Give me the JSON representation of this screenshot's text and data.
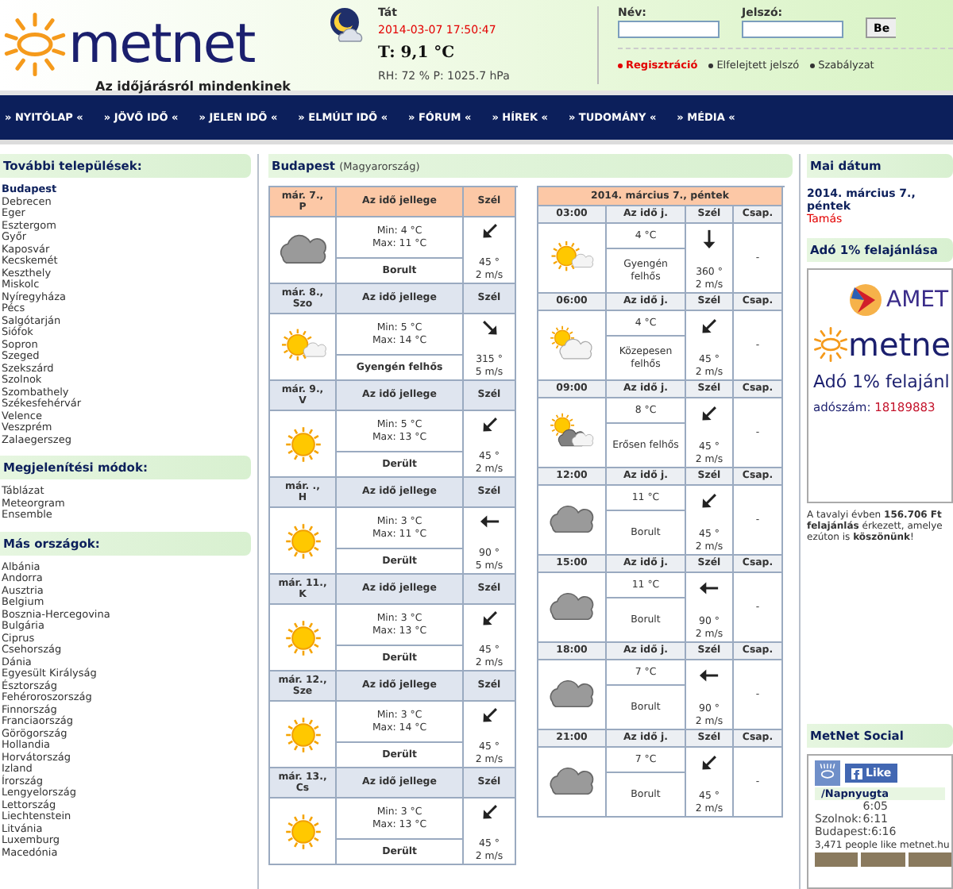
{
  "header": {
    "logo": "metnet",
    "tagline": "Az időjárásról mindenkinek",
    "station": "Tát",
    "datetime": "2014-03-07 17:50:47",
    "temperature": "T: 9,1 °C",
    "readings": "RH: 72 % P: 1025.7 hPa"
  },
  "login": {
    "name_label": "Név:",
    "password_label": "Jelszó:",
    "button": "Be",
    "links": [
      {
        "label": "Regisztráció",
        "kind": "highlight"
      },
      {
        "label": "Elfelejtett jelszó",
        "kind": "normal"
      },
      {
        "label": "Szabályzat",
        "kind": "normal"
      }
    ]
  },
  "nav": [
    "» NYITÓLAP «",
    "» JÖVŐ IDŐ «",
    "» JELEN IDŐ «",
    "» ELMÚLT IDŐ «",
    "» FÓRUM «",
    "» HÍREK «",
    "» TUDOMÁNY «",
    "» MÉDIA «"
  ],
  "sidebar": [
    {
      "title": "További települések:",
      "items": [
        {
          "label": "Budapest",
          "selected": true
        },
        {
          "label": "Debrecen",
          "selected": false
        },
        {
          "label": "Eger",
          "selected": false
        },
        {
          "label": "Esztergom",
          "selected": false
        },
        {
          "label": "Győr",
          "selected": false
        },
        {
          "label": "Kaposvár",
          "selected": false
        },
        {
          "label": "Kecskemét",
          "selected": false
        },
        {
          "label": "Keszthely",
          "selected": false
        },
        {
          "label": "Miskolc",
          "selected": false
        },
        {
          "label": "Nyíregyháza",
          "selected": false
        },
        {
          "label": "Pécs",
          "selected": false
        },
        {
          "label": "Salgótarján",
          "selected": false
        },
        {
          "label": "Siófok",
          "selected": false
        },
        {
          "label": "Sopron",
          "selected": false
        },
        {
          "label": "Szeged",
          "selected": false
        },
        {
          "label": "Szekszárd",
          "selected": false
        },
        {
          "label": "Szolnok",
          "selected": false
        },
        {
          "label": "Szombathely",
          "selected": false
        },
        {
          "label": "Székesfehérvár",
          "selected": false
        },
        {
          "label": "Velence",
          "selected": false
        },
        {
          "label": "Veszprém",
          "selected": false
        },
        {
          "label": "Zalaegerszeg",
          "selected": false
        }
      ]
    },
    {
      "title": "Megjelenítési módok:",
      "items": [
        {
          "label": "Táblázat",
          "selected": false
        },
        {
          "label": "Meteorgram",
          "selected": false
        },
        {
          "label": "Ensemble",
          "selected": false
        }
      ]
    },
    {
      "title": "Más országok:",
      "items": [
        {
          "label": "Albánia",
          "selected": false
        },
        {
          "label": "Andorra",
          "selected": false
        },
        {
          "label": "Ausztria",
          "selected": false
        },
        {
          "label": "Belgium",
          "selected": false
        },
        {
          "label": "Bosznia-Hercegovina",
          "selected": false
        },
        {
          "label": "Bulgária",
          "selected": false
        },
        {
          "label": "Ciprus",
          "selected": false
        },
        {
          "label": "Csehország",
          "selected": false
        },
        {
          "label": "Dánia",
          "selected": false
        },
        {
          "label": "Egyesült Királyság",
          "selected": false
        },
        {
          "label": "Észtország",
          "selected": false
        },
        {
          "label": "Fehéroroszország",
          "selected": false
        },
        {
          "label": "Finnország",
          "selected": false
        },
        {
          "label": "Franciaország",
          "selected": false
        },
        {
          "label": "Görögország",
          "selected": false
        },
        {
          "label": "Hollandia",
          "selected": false
        },
        {
          "label": "Horvátország",
          "selected": false
        },
        {
          "label": "Izland",
          "selected": false
        },
        {
          "label": "Írország",
          "selected": false
        },
        {
          "label": "Lengyelország",
          "selected": false
        },
        {
          "label": "Lettország",
          "selected": false
        },
        {
          "label": "Liechtenstein",
          "selected": false
        },
        {
          "label": "Litvánia",
          "selected": false
        },
        {
          "label": "Luxemburg",
          "selected": false
        },
        {
          "label": "Macedónia",
          "selected": false
        }
      ]
    }
  ],
  "forecast": {
    "title": "Budapest",
    "subtitle": "(Magyarország)",
    "days": [
      {
        "date": "már. 7.,",
        "weekday": "P",
        "desc_header": "Az idő jellege",
        "wind_header": "Szél",
        "kind": "cloudy",
        "min": "Min: 4 °C",
        "max": "Max: 11 °C",
        "description": "Borult",
        "wind_dir": "45 °",
        "wind_speed": "2 m/s",
        "selected": true
      },
      {
        "date": "már. 8.,",
        "weekday": "Szo",
        "desc_header": "Az idő jellege",
        "wind_header": "Szél",
        "kind": "fair",
        "min": "Min: 5 °C",
        "max": "Max: 14 °C",
        "description": "Gyengén felhős",
        "wind_dir": "315 °",
        "wind_speed": "5 m/s",
        "selected": false
      },
      {
        "date": "már. 9.,",
        "weekday": "V",
        "desc_header": "Az idő jellege",
        "wind_header": "Szél",
        "kind": "sunny",
        "min": "Min: 5 °C",
        "max": "Max: 13 °C",
        "description": "Derült",
        "wind_dir": "45 °",
        "wind_speed": "2 m/s",
        "selected": false
      },
      {
        "date": "már. .,",
        "weekday": "H",
        "desc_header": "Az idő jellege",
        "wind_header": "Szél",
        "kind": "sunny",
        "min": "Min: 3 °C",
        "max": "Max: 11 °C",
        "description": "Derült",
        "wind_dir": "90 °",
        "wind_speed": "5 m/s",
        "selected": false
      },
      {
        "date": "már. 11.,",
        "weekday": "K",
        "desc_header": "Az idő jellege",
        "wind_header": "Szél",
        "kind": "sunny",
        "min": "Min: 3 °C",
        "max": "Max: 13 °C",
        "description": "Derült",
        "wind_dir": "45 °",
        "wind_speed": "2 m/s",
        "selected": false
      },
      {
        "date": "már. 12.,",
        "weekday": "Sze",
        "desc_header": "Az idő jellege",
        "wind_header": "Szél",
        "kind": "sunny",
        "min": "Min: 3 °C",
        "max": "Max: 14 °C",
        "description": "Derült",
        "wind_dir": "45 °",
        "wind_speed": "2 m/s",
        "selected": false
      },
      {
        "date": "már. 13.,",
        "weekday": "Cs",
        "desc_header": "Az idő jellege",
        "wind_header": "Szél",
        "kind": "sunny",
        "min": "Min: 3 °C",
        "max": "Max: 13 °C",
        "description": "Derült",
        "wind_dir": "45 °",
        "wind_speed": "2 m/s",
        "selected": false
      }
    ]
  },
  "hourly": {
    "title": "2014. március 7., péntek",
    "hours": [
      {
        "time": "03:00",
        "desc_header": "Az idő j.",
        "wind_header": "Szél",
        "precip_header": "Csap.",
        "kind": "fair",
        "temp": "4 °C",
        "description": "Gyengén felhős",
        "wind_dir": "360 °",
        "wind_speed": "2 m/s",
        "precip": "-"
      },
      {
        "time": "06:00",
        "desc_header": "Az idő j.",
        "wind_header": "Szél",
        "precip_header": "Csap.",
        "kind": "partlycloudy",
        "temp": "4 °C",
        "description": "Közepesen felhős",
        "wind_dir": "45 °",
        "wind_speed": "2 m/s",
        "precip": "-"
      },
      {
        "time": "09:00",
        "desc_header": "Az idő j.",
        "wind_header": "Szél",
        "precip_header": "Csap.",
        "kind": "mostlycloudy",
        "temp": "8 °C",
        "description": "Erősen felhős",
        "wind_dir": "45 °",
        "wind_speed": "2 m/s",
        "precip": "-"
      },
      {
        "time": "12:00",
        "desc_header": "Az idő j.",
        "wind_header": "Szél",
        "precip_header": "Csap.",
        "kind": "cloudy",
        "temp": "11 °C",
        "description": "Borult",
        "wind_dir": "45 °",
        "wind_speed": "2 m/s",
        "precip": "-"
      },
      {
        "time": "15:00",
        "desc_header": "Az idő j.",
        "wind_header": "Szél",
        "precip_header": "Csap.",
        "kind": "cloudy",
        "temp": "11 °C",
        "description": "Borult",
        "wind_dir": "90 °",
        "wind_speed": "2 m/s",
        "precip": "-"
      },
      {
        "time": "18:00",
        "desc_header": "Az idő j.",
        "wind_header": "Szél",
        "precip_header": "Csap.",
        "kind": "cloudy",
        "temp": "7 °C",
        "description": "Borult",
        "wind_dir": "90 °",
        "wind_speed": "2 m/s",
        "precip": "-"
      },
      {
        "time": "21:00",
        "desc_header": "Az idő j.",
        "wind_header": "Szél",
        "precip_header": "Csap.",
        "kind": "cloudy",
        "temp": "7 °C",
        "description": "Borult",
        "wind_dir": "45 °",
        "wind_speed": "2 m/s",
        "precip": "-"
      }
    ]
  },
  "right": {
    "date_title": "Mai dátum",
    "date": "2014. március 7., péntek",
    "nameday": "Tamás",
    "tax_title": "Adó 1% felajánlása",
    "banner": {
      "partner": "AMET",
      "logo": "metne",
      "line": "Adó 1% felajánl",
      "tax_label": "adószám:",
      "tax_number": "18189883"
    },
    "thanks": [
      "A tavalyi évben **156.706 Ft**",
      "**felajánlás** érkezett, amelye",
      "ezúton is **köszönünk**!"
    ],
    "social_title": "MetNet Social",
    "sun_title": "/Napnyugta",
    "sun_rows": [
      {
        "time": "6:05"
      },
      {
        "city": "Szolnok:",
        "time": "6:11"
      },
      {
        "city": "Budapest:",
        "time": "6:16"
      }
    ],
    "like_button": "Like",
    "like_count": "3,471 people like metnet.hu"
  }
}
